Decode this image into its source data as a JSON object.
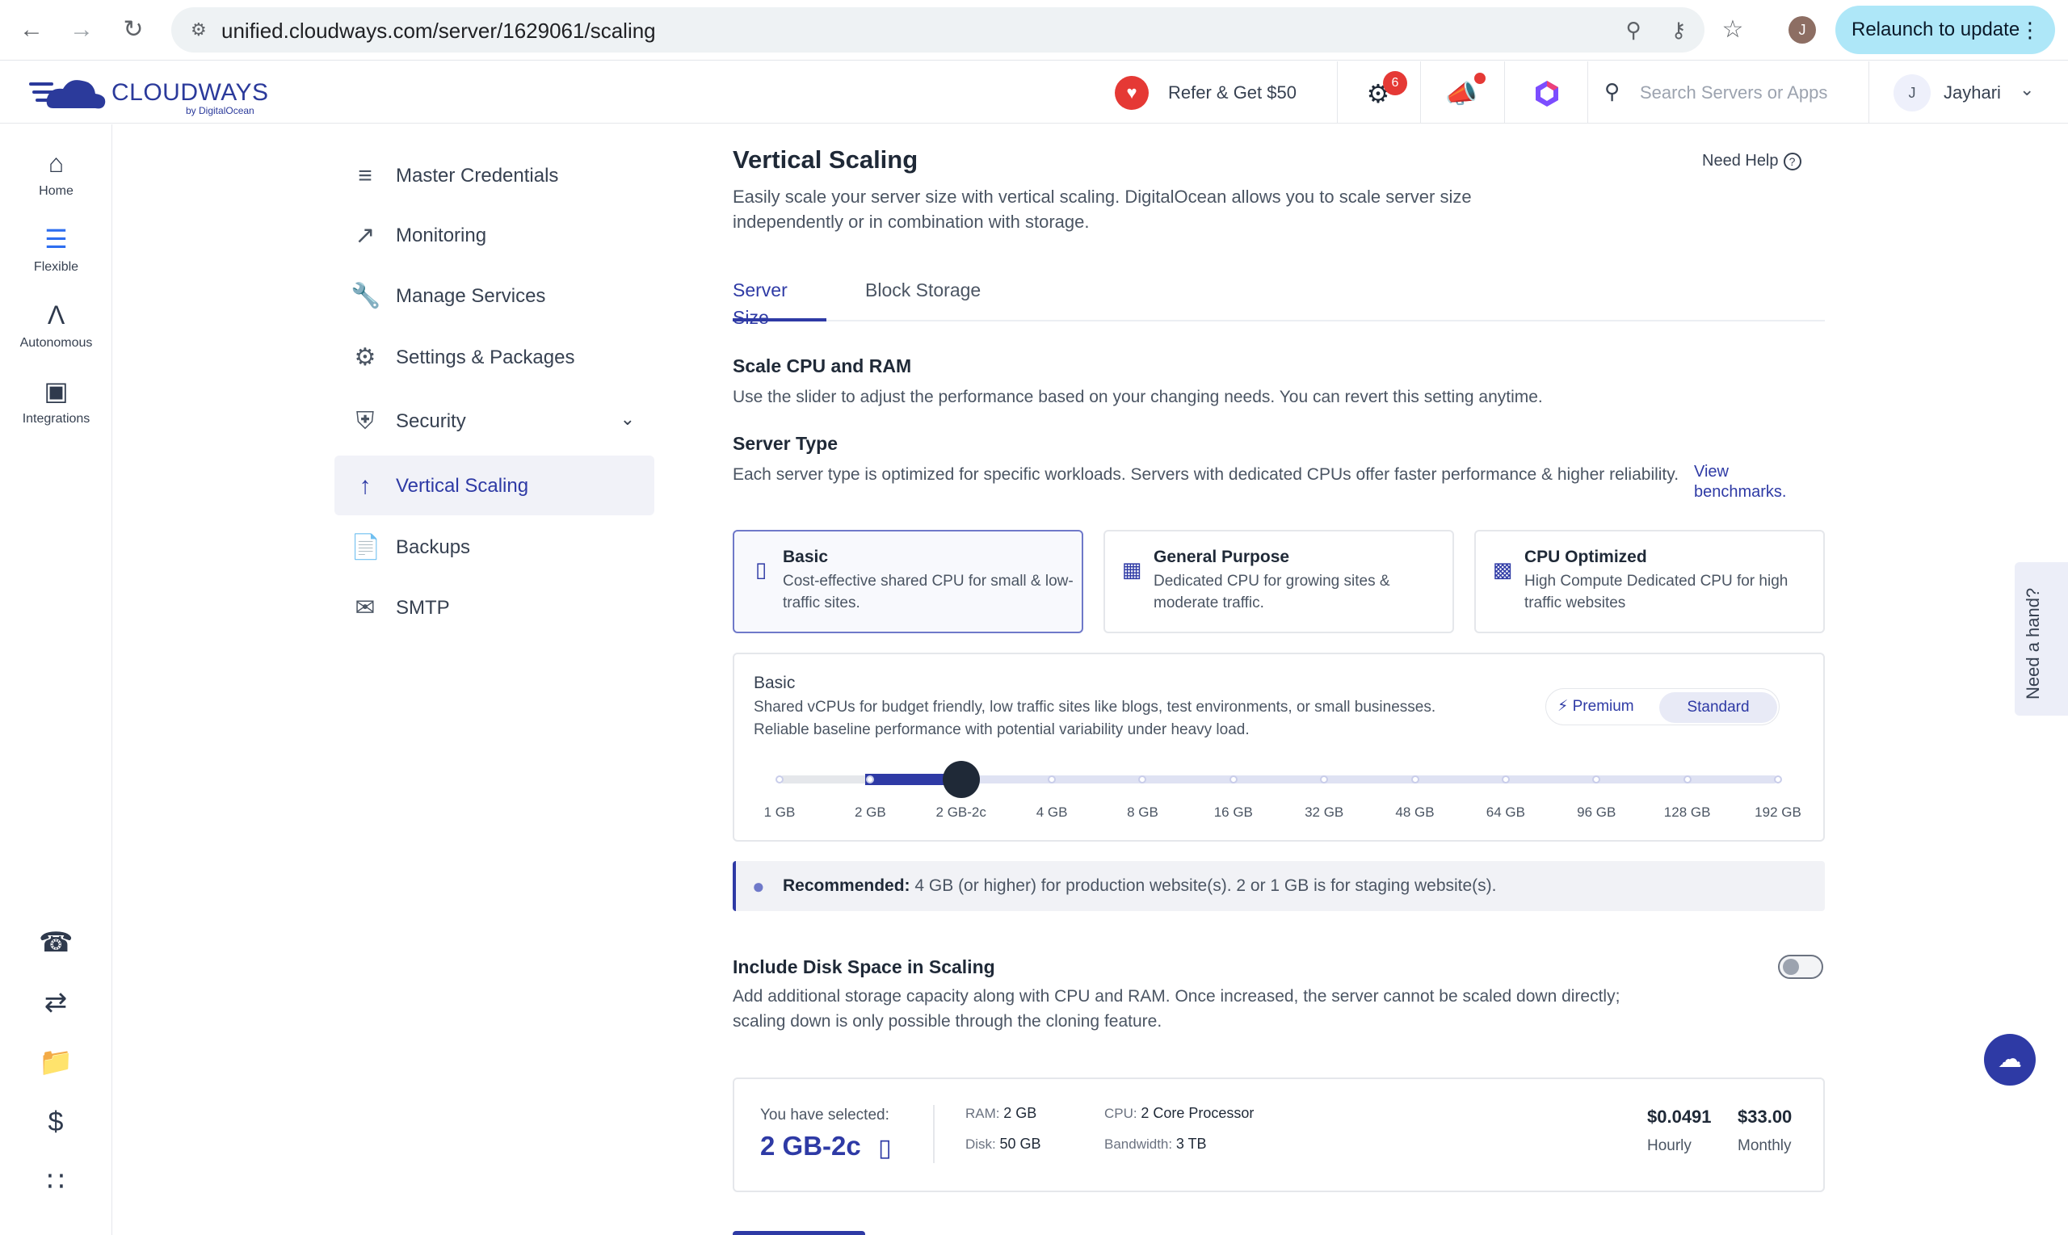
{
  "browser": {
    "url": "unified.cloudways.com/server/1629061/scaling",
    "profile_initial": "J",
    "relaunch_label": "Relaunch to update"
  },
  "header": {
    "logo_text": "CLOUDWAYS",
    "logo_sub": "by DigitalOcean",
    "refer_label": "Refer & Get $50",
    "notifications_count": "6",
    "search_placeholder": "Search Servers or Apps",
    "user_initial": "J",
    "user_name": "Jayhari"
  },
  "rail": {
    "items": [
      {
        "label": "Home",
        "icon": "home-icon"
      },
      {
        "label": "Flexible",
        "icon": "flexible-icon"
      },
      {
        "label": "Autonomous",
        "icon": "autonomous-icon"
      },
      {
        "label": "Integrations",
        "icon": "integrations-icon"
      }
    ]
  },
  "subnav": {
    "items": [
      {
        "label": "Master Credentials",
        "icon": "list-icon"
      },
      {
        "label": "Monitoring",
        "icon": "chart-icon"
      },
      {
        "label": "Manage Services",
        "icon": "wrench-icon"
      },
      {
        "label": "Settings & Packages",
        "icon": "gear-icon"
      },
      {
        "label": "Security",
        "icon": "shield-icon"
      },
      {
        "label": "Vertical Scaling",
        "icon": "arrow-up-icon"
      },
      {
        "label": "Backups",
        "icon": "backup-icon"
      },
      {
        "label": "SMTP",
        "icon": "mail-icon"
      }
    ]
  },
  "main": {
    "title": "Vertical Scaling",
    "need_help": "Need Help",
    "description": "Easily scale your server size with vertical scaling. DigitalOcean allows you to scale server size independently or in combination with storage.",
    "tabs": [
      "Server Size",
      "Block Storage"
    ],
    "scale_title": "Scale CPU and RAM",
    "scale_desc": "Use the slider to adjust the performance based on your changing needs. You can revert this setting anytime.",
    "server_type_title": "Server Type",
    "server_type_desc": "Each server type is optimized for specific workloads. Servers with dedicated CPUs offer faster performance & higher reliability.",
    "benchmarks_link": "View benchmarks.",
    "server_types": [
      {
        "name": "Basic",
        "desc": "Cost-effective shared CPU for small & low-traffic sites."
      },
      {
        "name": "General Purpose",
        "desc": "Dedicated CPU for growing sites & moderate traffic."
      },
      {
        "name": "CPU Optimized",
        "desc": "High Compute Dedicated CPU for high traffic websites"
      }
    ],
    "slider": {
      "title": "Basic",
      "desc": "Shared vCPUs for budget friendly, low traffic sites like blogs, test environments, or small businesses. Reliable baseline performance with potential variability under heavy load.",
      "premium_label": "Premium",
      "standard_label": "Standard",
      "sizes": [
        "1 GB",
        "2 GB",
        "2 GB-2c",
        "4 GB",
        "8 GB",
        "16 GB",
        "32 GB",
        "48 GB",
        "64 GB",
        "96 GB",
        "128 GB",
        "192 GB"
      ],
      "selected": "2 GB-2c"
    },
    "recommended_label": "Recommended:",
    "recommended_text": "4 GB (or higher) for production website(s). 2 or 1 GB is for staging website(s).",
    "disk_title": "Include Disk Space in Scaling",
    "disk_desc": "Add additional storage capacity along with CPU and RAM. Once increased, the server cannot be scaled down directly; scaling down is only possible through the cloning feature.",
    "summary": {
      "selected_label": "You have selected:",
      "selected_value": "2 GB-2c",
      "ram_label": "RAM:",
      "ram_value": "2 GB",
      "disk_label": "Disk:",
      "disk_value": "50 GB",
      "cpu_label": "CPU:",
      "cpu_value": "2 Core Processor",
      "bandwidth_label": "Bandwidth:",
      "bandwidth_value": "3 TB",
      "hourly_price": "$0.0491",
      "hourly_label": "Hourly",
      "monthly_price": "$33.00",
      "monthly_label": "Monthly"
    }
  },
  "side_tab": "Need a hand?"
}
